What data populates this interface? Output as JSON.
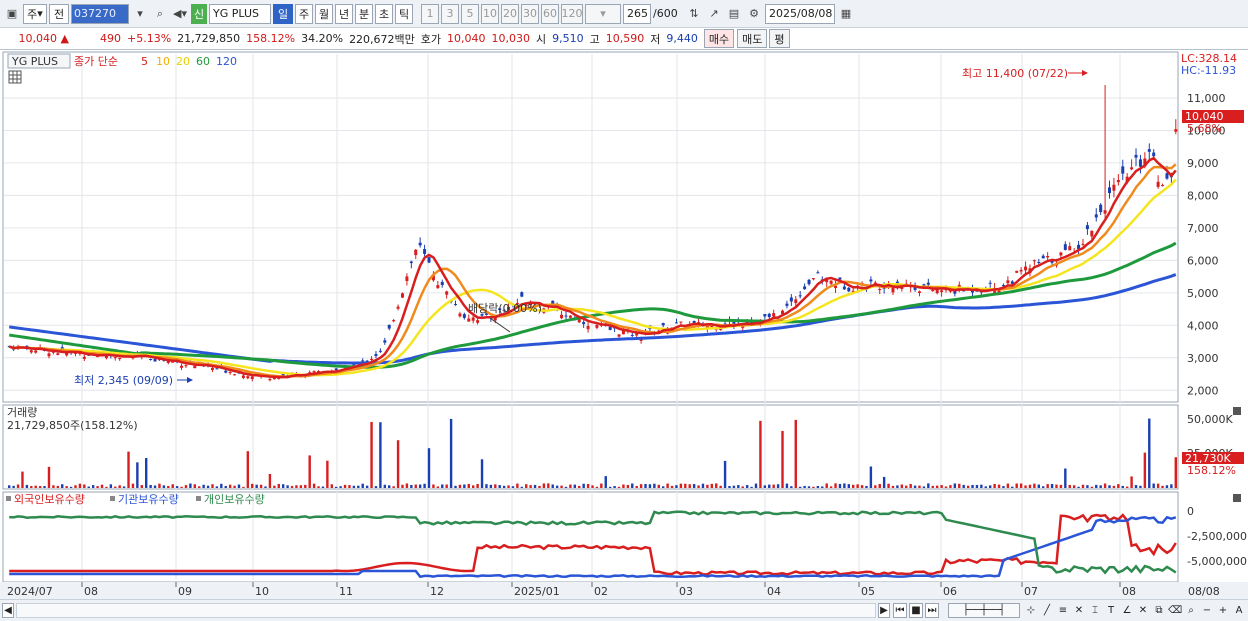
{
  "toolbar": {
    "market_type": "주",
    "prev_label": "전",
    "code": "037270",
    "new_badge": "신",
    "name": "YG PLUS",
    "periods": [
      "일",
      "주",
      "월",
      "년",
      "분",
      "초",
      "틱"
    ],
    "active_period": "일",
    "intervals": [
      "1",
      "3",
      "5",
      "10",
      "20",
      "30",
      "60",
      "120"
    ],
    "count_value": "265",
    "count_total": "/600",
    "date": "2025/08/08"
  },
  "quote": {
    "price": "10,040",
    "arrow": "▲",
    "change": "490",
    "change_pct": "+5.13%",
    "volume": "21,729,850",
    "vol_ratio": "158.12%",
    "turnover": "34.20%",
    "amount": "220,672백만",
    "ask_label": "호가",
    "ask": "10,040",
    "bid": "10,030",
    "open_label": "시",
    "open": "9,510",
    "high_label": "고",
    "high": "10,590",
    "low_label": "저",
    "low": "9,440",
    "buy_label": "매수",
    "sell_label": "매도",
    "eval_label": "평"
  },
  "price_panel": {
    "legend_name": "YG PLUS",
    "legend_type": "종가 단순",
    "ma_labels": [
      "5",
      "10",
      "20",
      "60",
      "120"
    ],
    "lc_label": "LC:328.14",
    "hc_label": "HC:-11.93",
    "max_label": "최고 11,400 (07/22)",
    "min_label": "최저 2,345 (09/09)",
    "dividend_label": "배당락(0.00%)",
    "current_tag": "10,040",
    "current_pct": "5.68%",
    "y_ticks": [
      "11,000",
      "10,000",
      "9,000",
      "8,000",
      "7,000",
      "6,000",
      "5,000",
      "4,000",
      "3,000",
      "2,000"
    ]
  },
  "volume_panel": {
    "title": "거래량",
    "value_label": "21,729,850주(158.12%)",
    "y_tick": "50,000K",
    "y_tick2": "25,000K",
    "current_tag": "21,730K",
    "current_pct": "158.12%"
  },
  "holding_panel": {
    "legend": [
      "외국인보유수량",
      "기관보유수량",
      "개인보유수량"
    ],
    "y_ticks": [
      "0",
      "-2,500,000",
      "-5,000,000"
    ]
  },
  "x_axis": {
    "labels": [
      "2024/07",
      "08",
      "09",
      "10",
      "11",
      "12",
      "2025/01",
      "02",
      "03",
      "04",
      "05",
      "06",
      "07",
      "08"
    ],
    "right_label": "08/08"
  },
  "colors": {
    "ma5": "#d81e1e",
    "ma10": "#f08a1c",
    "ma20": "#f5e51e",
    "ma60": "#1e9a3c",
    "ma120": "#2a55d6",
    "up": "#d81e1e",
    "down": "#1a3fb0",
    "foreign": "#d81e1e",
    "institution": "#2a55d6",
    "individual": "#2e8a4e"
  },
  "chart_data": {
    "type": "candlestick",
    "x_range": [
      "2024/07",
      "2025/08/08"
    ],
    "price_ylim": [
      2000,
      11000
    ],
    "monthly_closes": [
      3300,
      2900,
      2500,
      3000,
      4300,
      4300,
      3800,
      4200,
      5500,
      5100,
      5300,
      6200,
      8500,
      10040
    ],
    "current": 10040,
    "max": {
      "value": 11400,
      "date": "07/22"
    },
    "min": {
      "value": 2345,
      "date": "09/09"
    }
  }
}
